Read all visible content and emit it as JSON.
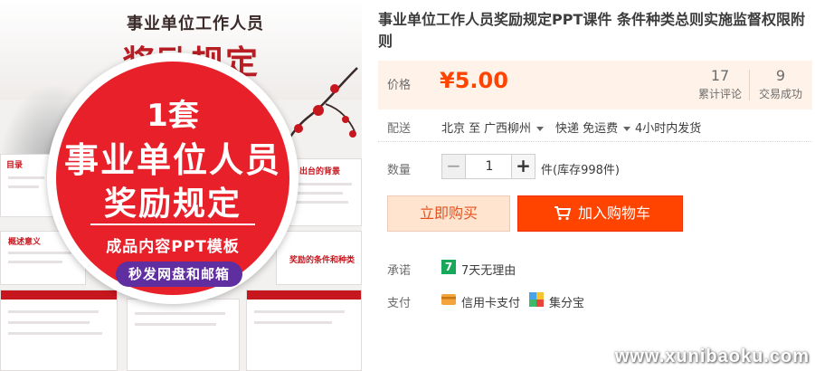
{
  "product_image": {
    "slide_title_small": "事业单位工作人员",
    "slide_title_big": "奖励规定",
    "badge_number": "1套",
    "badge_line1": "事业单位人员",
    "badge_line2": "奖励规定",
    "badge_sub": "成品内容PPT模板",
    "badge_pill": "秒发网盘和邮箱",
    "mini_slide_texts": [
      "出台的背景",
      "奖励的条件和种类",
      "目录",
      "概述意义"
    ],
    "brand_red": "#e8202a",
    "pill_purple": "#5f2ea0"
  },
  "product": {
    "title": "事业单位工作人员奖励规定PPT课件 条件种类总则实施监督权限附则"
  },
  "price": {
    "label": "价格",
    "value": "¥5.00",
    "accent_color": "#ff4400"
  },
  "stats": {
    "reviews_count": "17",
    "reviews_label": "累计评论",
    "sales_count": "9",
    "sales_label": "交易成功"
  },
  "shipping": {
    "label": "配送",
    "from": "北京 至",
    "to": "广西柳州",
    "method": "快递 免运费",
    "dispatch": "4小时内发货"
  },
  "quantity": {
    "label": "数量",
    "value": "1",
    "minus": "−",
    "plus": "+",
    "stock": "件(库存998件)"
  },
  "actions": {
    "buy_now": "立即购买",
    "add_to_cart": "加入购物车"
  },
  "promise": {
    "label": "承诺",
    "icon_char": "7",
    "text": "7天无理由"
  },
  "payment": {
    "label": "支付",
    "method1": "信用卡支付",
    "method2": "集分宝"
  },
  "watermark": "www.xunibaoku.com"
}
